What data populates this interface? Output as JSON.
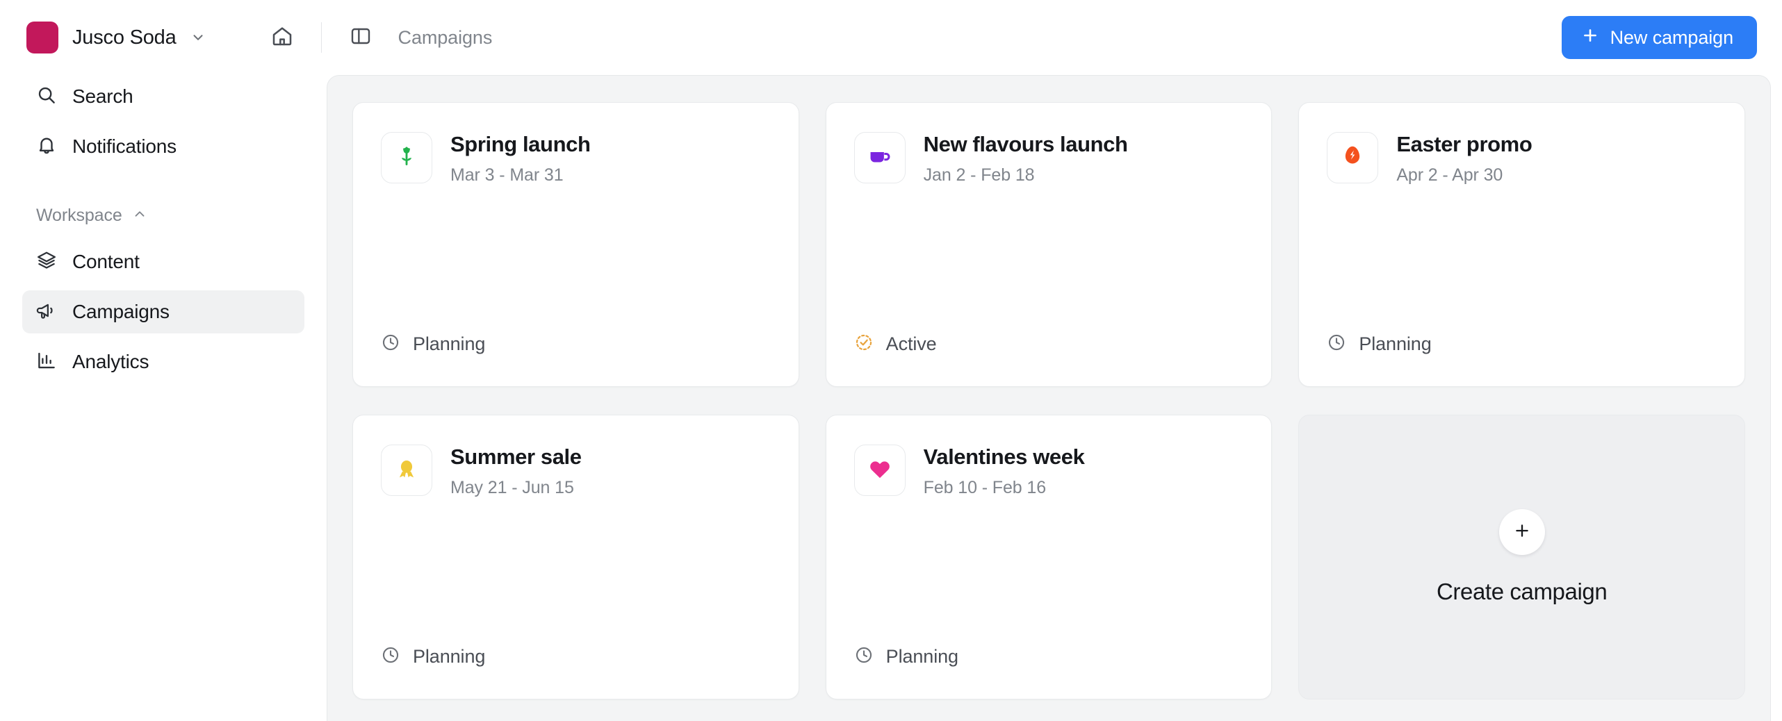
{
  "topbar": {
    "workspace_name": "Jusco Soda",
    "workspace_logo_color": "#c2185b",
    "workspace_chevron_icon": "chevron-down-icon",
    "home_icon": "home-icon",
    "sidebar_toggle_icon": "panel-left-icon",
    "breadcrumb": "Campaigns",
    "new_campaign_label": "New campaign",
    "new_campaign_icon": "plus-icon",
    "accent_color": "#2c7df6"
  },
  "sidebar": {
    "top_items": [
      {
        "label": "Search",
        "icon": "search-icon",
        "selected": false
      },
      {
        "label": "Notifications",
        "icon": "bell-icon",
        "selected": false
      }
    ],
    "section_label": "Workspace",
    "section_icon": "chevron-up-icon",
    "items": [
      {
        "label": "Content",
        "icon": "layers-icon",
        "selected": false
      },
      {
        "label": "Campaigns",
        "icon": "megaphone-icon",
        "selected": true
      },
      {
        "label": "Analytics",
        "icon": "bar-chart-icon",
        "selected": false
      }
    ],
    "selected_bg": "#f0f1f2"
  },
  "main": {
    "cards": [
      {
        "title": "Spring launch",
        "dates": "Mar 3 - Mar 31",
        "icon": "tulip-icon",
        "icon_color": "#22b24c",
        "status": "Planning",
        "status_icon": "clock-icon",
        "status_color": "#6d7177"
      },
      {
        "title": "New flavours launch",
        "dates": "Jan 2 - Feb 18",
        "icon": "mug-icon",
        "icon_color": "#7b25e0",
        "status": "Active",
        "status_icon": "check-dashed-circle-icon",
        "status_color": "#e8a33d"
      },
      {
        "title": "Easter promo",
        "dates": "Apr 2 - Apr 30",
        "icon": "egg-icon",
        "icon_color": "#f4511e",
        "status": "Planning",
        "status_icon": "clock-icon",
        "status_color": "#6d7177"
      },
      {
        "title": "Summer sale",
        "dates": "May 21 - Jun 15",
        "icon": "medal-icon",
        "icon_color": "#f0c93a",
        "status": "Planning",
        "status_icon": "clock-icon",
        "status_color": "#6d7177"
      },
      {
        "title": "Valentines week",
        "dates": "Feb 10 - Feb 16",
        "icon": "heart-icon",
        "icon_color": "#ec2e8f",
        "status": "Planning",
        "status_icon": "clock-icon",
        "status_color": "#6d7177"
      }
    ],
    "create_tile": {
      "label": "Create campaign",
      "icon": "plus-icon"
    }
  }
}
